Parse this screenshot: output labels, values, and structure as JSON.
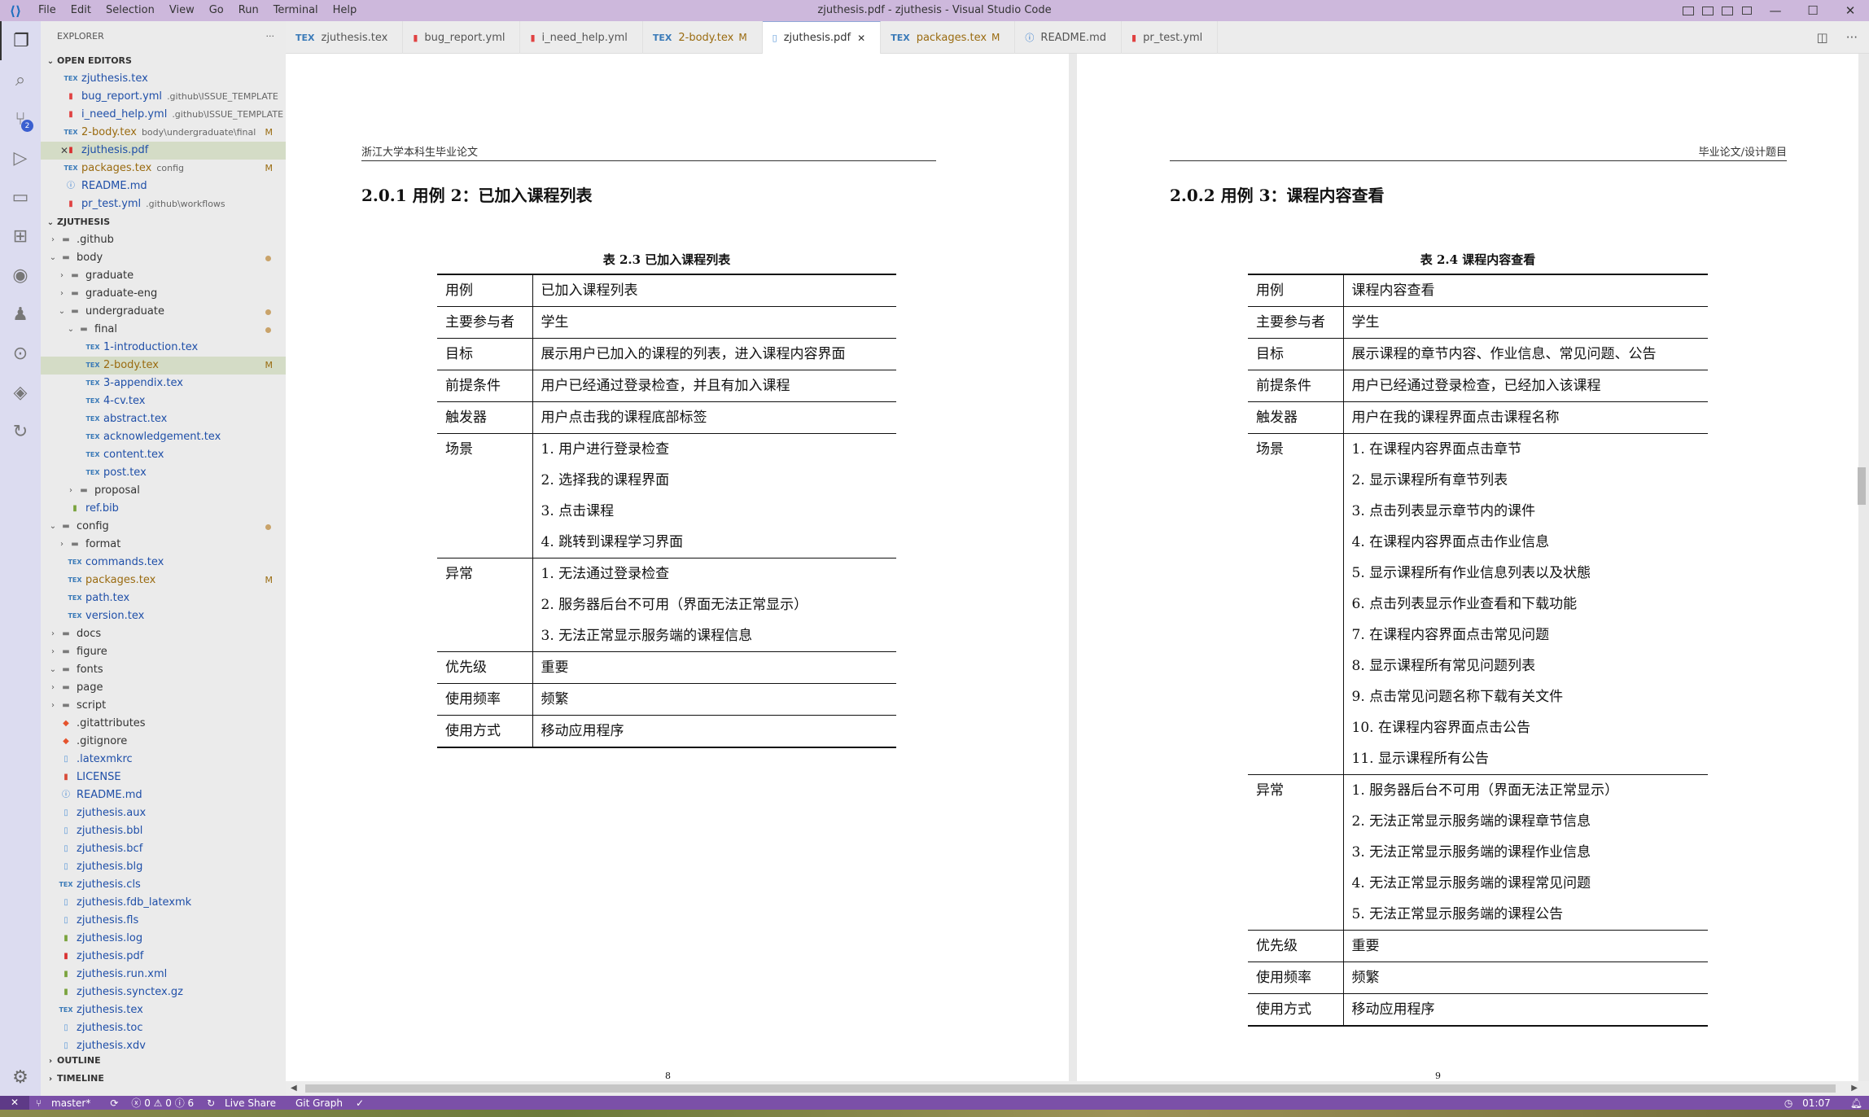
{
  "window": {
    "title": "zjuthesis.pdf - zjuthesis - Visual Studio Code",
    "menu": [
      "File",
      "Edit",
      "Selection",
      "View",
      "Go",
      "Run",
      "Terminal",
      "Help"
    ]
  },
  "activity": {
    "scm_badge": "2"
  },
  "sidebar": {
    "title": "EXPLORER",
    "more": "···",
    "open_editors_header": "OPEN EDITORS",
    "project_header": "ZJUTHESIS",
    "outline_header": "OUTLINE",
    "timeline_header": "TIMELINE",
    "open_editors": [
      {
        "name": "zjuthesis.tex",
        "desc": "",
        "icon": "tex",
        "status": ""
      },
      {
        "name": "bug_report.yml",
        "desc": ".github\\ISSUE_TEMPLATE",
        "icon": "yml",
        "status": ""
      },
      {
        "name": "i_need_help.yml",
        "desc": ".github\\ISSUE_TEMPLATE",
        "icon": "yml",
        "status": ""
      },
      {
        "name": "2-body.tex",
        "desc": "body\\undergraduate\\final",
        "icon": "tex",
        "status": "M"
      },
      {
        "name": "zjuthesis.pdf",
        "desc": "",
        "icon": "pdf",
        "status": ""
      },
      {
        "name": "packages.tex",
        "desc": "config",
        "icon": "tex",
        "status": "M"
      },
      {
        "name": "README.md",
        "desc": "",
        "icon": "info",
        "status": ""
      },
      {
        "name": "pr_test.yml",
        "desc": ".github\\workflows",
        "icon": "yml",
        "status": ""
      }
    ],
    "tree": [
      {
        "name": ".github",
        "depth": 0,
        "type": "folder",
        "open": false
      },
      {
        "name": "body",
        "depth": 0,
        "type": "folder",
        "open": true,
        "dot": true
      },
      {
        "name": "graduate",
        "depth": 1,
        "type": "folder",
        "open": false
      },
      {
        "name": "graduate-eng",
        "depth": 1,
        "type": "folder",
        "open": false
      },
      {
        "name": "undergraduate",
        "depth": 1,
        "type": "folder",
        "open": true,
        "dot": true
      },
      {
        "name": "final",
        "depth": 2,
        "type": "folder",
        "open": true,
        "dot": true
      },
      {
        "name": "1-introduction.tex",
        "depth": 3,
        "type": "tex"
      },
      {
        "name": "2-body.tex",
        "depth": 3,
        "type": "tex",
        "status": "M"
      },
      {
        "name": "3-appendix.tex",
        "depth": 3,
        "type": "tex"
      },
      {
        "name": "4-cv.tex",
        "depth": 3,
        "type": "tex"
      },
      {
        "name": "abstract.tex",
        "depth": 3,
        "type": "tex"
      },
      {
        "name": "acknowledgement.tex",
        "depth": 3,
        "type": "tex"
      },
      {
        "name": "content.tex",
        "depth": 3,
        "type": "tex"
      },
      {
        "name": "post.tex",
        "depth": 3,
        "type": "tex"
      },
      {
        "name": "proposal",
        "depth": 2,
        "type": "folder",
        "open": false
      },
      {
        "name": "ref.bib",
        "depth": 1,
        "type": "bib"
      },
      {
        "name": "config",
        "depth": 0,
        "type": "folder",
        "open": true,
        "dot": true
      },
      {
        "name": "format",
        "depth": 1,
        "type": "folder",
        "open": false
      },
      {
        "name": "commands.tex",
        "depth": 1,
        "type": "tex"
      },
      {
        "name": "packages.tex",
        "depth": 1,
        "type": "tex",
        "status": "M"
      },
      {
        "name": "path.tex",
        "depth": 1,
        "type": "tex"
      },
      {
        "name": "version.tex",
        "depth": 1,
        "type": "tex"
      },
      {
        "name": "docs",
        "depth": 0,
        "type": "folder",
        "open": false
      },
      {
        "name": "figure",
        "depth": 0,
        "type": "folder",
        "open": false
      },
      {
        "name": "fonts",
        "depth": 0,
        "type": "folder",
        "open": true
      },
      {
        "name": "page",
        "depth": 0,
        "type": "folder",
        "open": false
      },
      {
        "name": "script",
        "depth": 0,
        "type": "folder",
        "open": false
      },
      {
        "name": ".gitattributes",
        "depth": 0,
        "type": "git"
      },
      {
        "name": ".gitignore",
        "depth": 0,
        "type": "git"
      },
      {
        "name": ".latexmkrc",
        "depth": 0,
        "type": "file"
      },
      {
        "name": "LICENSE",
        "depth": 0,
        "type": "lic"
      },
      {
        "name": "README.md",
        "depth": 0,
        "type": "info"
      },
      {
        "name": "zjuthesis.aux",
        "depth": 0,
        "type": "file"
      },
      {
        "name": "zjuthesis.bbl",
        "depth": 0,
        "type": "file"
      },
      {
        "name": "zjuthesis.bcf",
        "depth": 0,
        "type": "file"
      },
      {
        "name": "zjuthesis.blg",
        "depth": 0,
        "type": "file"
      },
      {
        "name": "zjuthesis.cls",
        "depth": 0,
        "type": "tex"
      },
      {
        "name": "zjuthesis.fdb_latexmk",
        "depth": 0,
        "type": "file"
      },
      {
        "name": "zjuthesis.fls",
        "depth": 0,
        "type": "file"
      },
      {
        "name": "zjuthesis.log",
        "depth": 0,
        "type": "bib"
      },
      {
        "name": "zjuthesis.pdf",
        "depth": 0,
        "type": "pdf"
      },
      {
        "name": "zjuthesis.run.xml",
        "depth": 0,
        "type": "bib"
      },
      {
        "name": "zjuthesis.synctex.gz",
        "depth": 0,
        "type": "bib"
      },
      {
        "name": "zjuthesis.tex",
        "depth": 0,
        "type": "tex"
      },
      {
        "name": "zjuthesis.toc",
        "depth": 0,
        "type": "file"
      },
      {
        "name": "zjuthesis.xdv",
        "depth": 0,
        "type": "file"
      }
    ]
  },
  "tabs": [
    {
      "label": "zjuthesis.tex",
      "icon": "tex",
      "status": "",
      "active": false
    },
    {
      "label": "bug_report.yml",
      "icon": "yml",
      "status": "",
      "active": false
    },
    {
      "label": "i_need_help.yml",
      "icon": "yml",
      "status": "",
      "active": false
    },
    {
      "label": "2-body.tex",
      "icon": "tex",
      "status": "M",
      "active": false
    },
    {
      "label": "zjuthesis.pdf",
      "icon": "pdf-doc",
      "status": "",
      "active": true
    },
    {
      "label": "packages.tex",
      "icon": "tex",
      "status": "M",
      "active": false
    },
    {
      "label": "README.md",
      "icon": "info",
      "status": "",
      "active": false
    },
    {
      "label": "pr_test.yml",
      "icon": "yml",
      "status": "",
      "active": false
    }
  ],
  "pdf": {
    "page1": {
      "header": "浙江大学本科生毕业论文",
      "section": "2.0.1 用例 2：已加入课程列表",
      "caption": "表 2.3 已加入课程列表",
      "rows": [
        {
          "k": "用例",
          "v": [
            "已加入课程列表"
          ]
        },
        {
          "k": "主要参与者",
          "v": [
            "学生"
          ]
        },
        {
          "k": "目标",
          "v": [
            "展示用户已加入的课程的列表，进入课程内容界面"
          ]
        },
        {
          "k": "前提条件",
          "v": [
            "用户已经通过登录检查，并且有加入课程"
          ]
        },
        {
          "k": "触发器",
          "v": [
            "用户点击我的课程底部标签"
          ]
        },
        {
          "k": "场景",
          "v": [
            "1. 用户进行登录检查",
            "2. 选择我的课程界面",
            "3. 点击课程",
            "4. 跳转到课程学习界面"
          ]
        },
        {
          "k": "异常",
          "v": [
            "1. 无法通过登录检查",
            "2. 服务器后台不可用（界面无法正常显示）",
            "3. 无法正常显示服务端的课程信息"
          ]
        },
        {
          "k": "优先级",
          "v": [
            "重要"
          ]
        },
        {
          "k": "使用频率",
          "v": [
            "频繁"
          ]
        },
        {
          "k": "使用方式",
          "v": [
            "移动应用程序"
          ]
        }
      ]
    },
    "page2": {
      "header": "毕业论文/设计题目",
      "section": "2.0.2 用例 3：课程内容查看",
      "caption": "表 2.4 课程内容查看",
      "rows": [
        {
          "k": "用例",
          "v": [
            "课程内容查看"
          ]
        },
        {
          "k": "主要参与者",
          "v": [
            "学生"
          ]
        },
        {
          "k": "目标",
          "v": [
            "展示课程的章节内容、作业信息、常见问题、公告"
          ]
        },
        {
          "k": "前提条件",
          "v": [
            "用户已经通过登录检查，已经加入该课程"
          ]
        },
        {
          "k": "触发器",
          "v": [
            "用户在我的课程界面点击课程名称"
          ]
        },
        {
          "k": "场景",
          "v": [
            "1. 在课程内容界面点击章节",
            "2. 显示课程所有章节列表",
            "3. 点击列表显示章节内的课件",
            "4. 在课程内容界面点击作业信息",
            "5. 显示课程所有作业信息列表以及状態",
            "6. 点击列表显示作业查看和下载功能",
            "7. 在课程内容界面点击常见问题",
            "8. 显示课程所有常见问题列表",
            "9. 点击常见问题名称下载有关文件",
            "10. 在课程内容界面点击公告",
            "11. 显示课程所有公告"
          ]
        },
        {
          "k": "异常",
          "v": [
            "1. 服务器后台不可用（界面无法正常显示）",
            "2. 无法正常显示服务端的课程章节信息",
            "3. 无法正常显示服务端的课程作业信息",
            "4. 无法正常显示服务端的课程常见问题",
            "5. 无法正常显示服务端的课程公告"
          ]
        },
        {
          "k": "优先级",
          "v": [
            "重要"
          ]
        },
        {
          "k": "使用频率",
          "v": [
            "频繁"
          ]
        },
        {
          "k": "使用方式",
          "v": [
            "移动应用程序"
          ]
        }
      ]
    }
  },
  "status": {
    "branch": "master*",
    "sync": "⟳",
    "problems": "ⓧ 0 ⚠ 0 ⓘ 6",
    "live_share": "Live Share",
    "git_graph": "Git Graph",
    "check": "✓",
    "time": "01:07"
  }
}
